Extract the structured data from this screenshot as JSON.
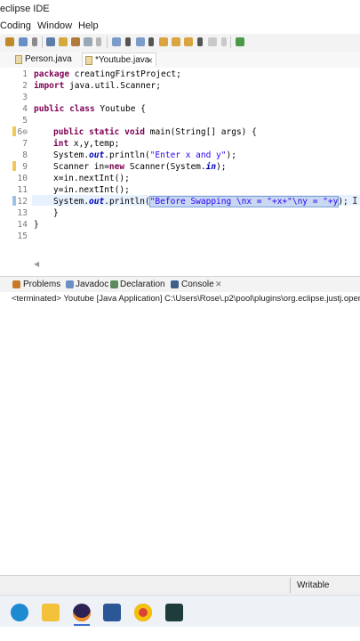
{
  "window": {
    "title": "eclipse IDE"
  },
  "menu": [
    "Coding",
    "Window",
    "Help"
  ],
  "tabs": [
    {
      "label": "Person.java"
    },
    {
      "label": "*Youtube.java",
      "close": "✕"
    }
  ],
  "editor": {
    "line_numbers": [
      "1",
      "2",
      "3",
      "4",
      "5",
      "6⊖",
      "7",
      "8",
      "9",
      "10",
      "11",
      "12",
      "13",
      "14",
      "15"
    ]
  },
  "code": {
    "l1_kw": "package",
    "l1_rest": " creatingFirstProject;",
    "l2_kw": "import",
    "l2_rest": " java.util.Scanner;",
    "l4_kw1": "public",
    "l4_kw2": "class",
    "l4_rest": " Youtube {",
    "l6_kw1": "public",
    "l6_kw2": "static",
    "l6_kw3": "void",
    "l6_rest": " main(String[] args) {",
    "l7_kw": "int",
    "l7_rest": " x,y,temp;",
    "l8_a": "System.",
    "l8_out": "out",
    "l8_b": ".println(",
    "l8_str": "\"Enter x and y\"",
    "l8_c": ");",
    "l9_a": "Scanner in=",
    "l9_kw": "new",
    "l9_b": " Scanner(System.",
    "l9_in": "in",
    "l9_c": ");",
    "l10": "x=in.nextInt();",
    "l11": "y=in.nextInt();",
    "l12_a": "System.",
    "l12_out": "out",
    "l12_b": ".println(",
    "l12_sel": "\"Before Swapping \\nx = \"+x+\"\\ny = \"+y",
    "l12_c": ");",
    "l13": "}",
    "l14": "}"
  },
  "panel": {
    "tabs": [
      "Problems",
      "Javadoc",
      "Declaration",
      "Console"
    ],
    "active": "Console",
    "console_text": "<terminated> Youtube [Java Application] C:\\Users\\Rose\\.p2\\pool\\plugins\\org.eclipse.justj.openj"
  },
  "status": {
    "mode": "Writable"
  },
  "taskbar": [
    "edge-icon",
    "file-explorer-icon",
    "eclipse-icon",
    "word-icon",
    "chrome-icon",
    "terminal-icon"
  ]
}
